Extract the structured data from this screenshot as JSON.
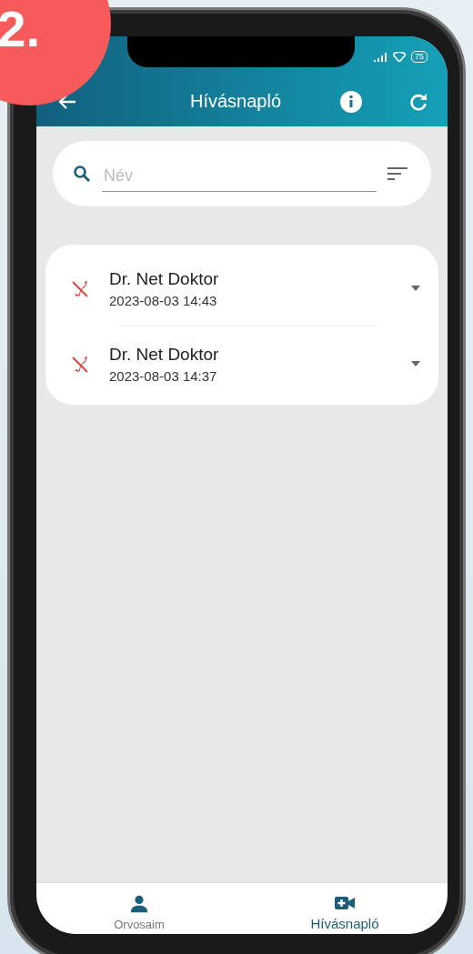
{
  "badge": "2.",
  "status_bar": {
    "battery": "75"
  },
  "app_bar": {
    "title": "Hívásnapló"
  },
  "search": {
    "placeholder": "Név"
  },
  "calls": [
    {
      "kind": "missed",
      "name": "Dr. Net Doktor",
      "time": "2023-08-03 14:43"
    },
    {
      "kind": "missed",
      "name": "Dr. Net Doktor",
      "time": "2023-08-03 14:37"
    }
  ],
  "bottom_nav": [
    {
      "kind": "person",
      "label": "Orvosaim",
      "selected": false
    },
    {
      "kind": "video",
      "label": "Hívásnapló",
      "selected": true
    }
  ]
}
